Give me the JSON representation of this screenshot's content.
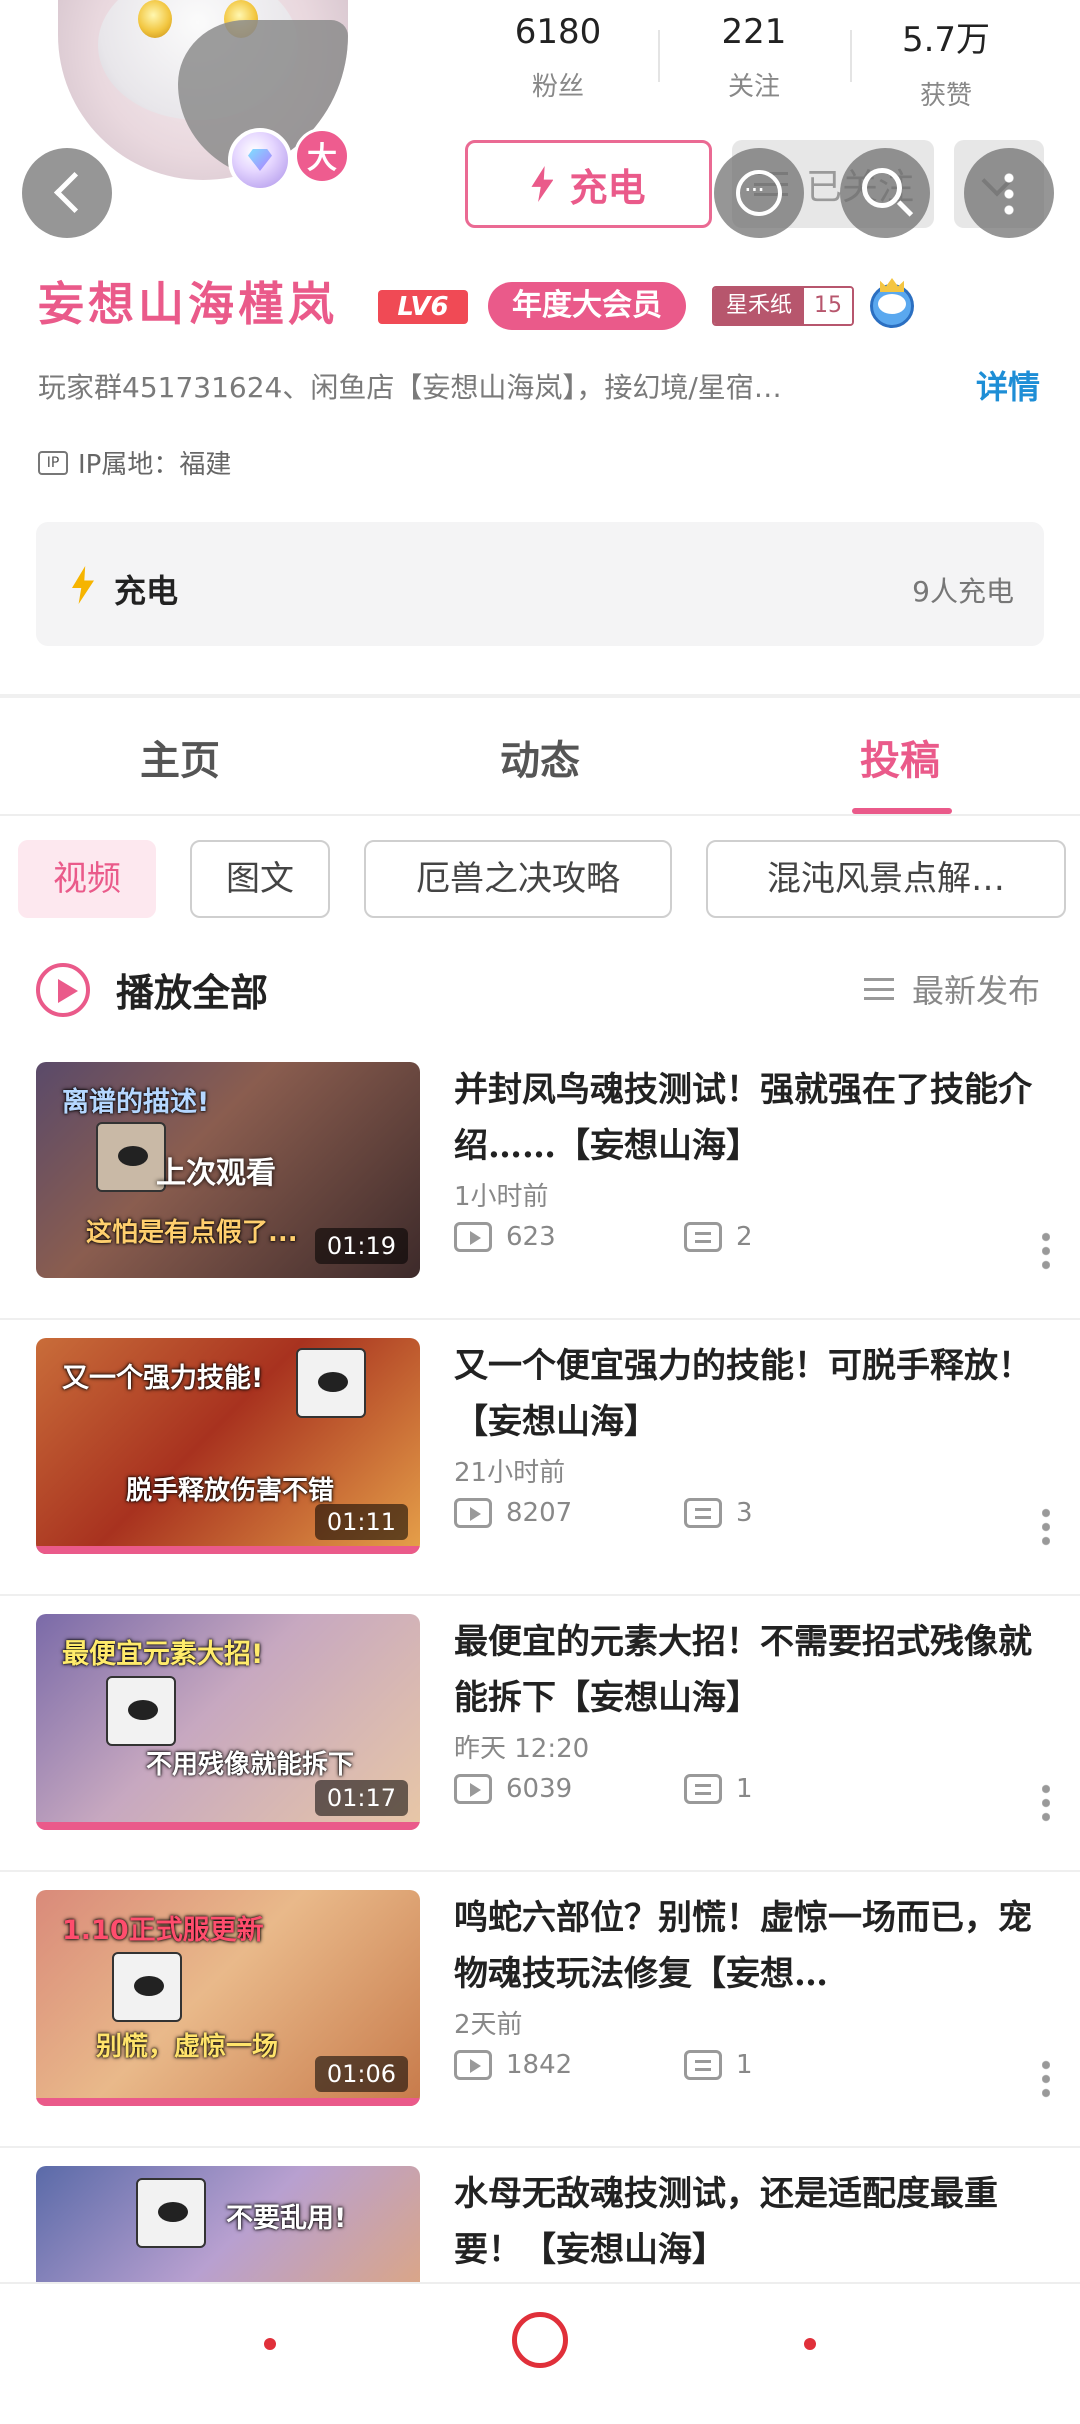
{
  "header": {
    "stats": [
      {
        "value": "6180",
        "label": "粉丝"
      },
      {
        "value": "221",
        "label": "关注"
      },
      {
        "value": "5.7万",
        "label": "获赞"
      }
    ],
    "avatar_badge": "大",
    "charge_button": "充电",
    "follow_button": "已关注",
    "colors": {
      "accent": "#ea5a8a",
      "link": "#1e8ed6",
      "level": "#f04a55",
      "nav": "#e0303a"
    }
  },
  "profile": {
    "name": "妄想山海槿岚",
    "level": "LV6",
    "member": "年度大会员",
    "medal_name": "星禾纸",
    "medal_level": "15",
    "bio": "玩家群451731624、闲鱼店【妄想山海岚】，接幻境/星宿…",
    "bio_more": "详情",
    "ip_label": "IP属地：福建",
    "charge_title": "充电",
    "charge_count": "9人充电"
  },
  "tabs": [
    "主页",
    "动态",
    "投稿"
  ],
  "active_tab": 2,
  "chips": [
    "视频",
    "图文",
    "厄兽之决攻略",
    "混沌风景点解…"
  ],
  "active_chip": 0,
  "list_header": {
    "play_all": "播放全部",
    "sort": "最新发布"
  },
  "videos": [
    {
      "title": "并封凤鸟魂技测试！强就强在了技能介绍……【妄想山海】",
      "date": "1小时前",
      "views": "623",
      "comments": "2",
      "duration": "01:19",
      "thumb_top": "离谱的描述!",
      "thumb_bottom": "这怕是有点假了...",
      "watched_label": "上次观看",
      "progress": 0
    },
    {
      "title": "又一个便宜强力的技能！可脱手释放！【妄想山海】",
      "date": "21小时前",
      "views": "8207",
      "comments": "3",
      "duration": "01:11",
      "thumb_top": "又一个强力技能!",
      "thumb_bottom": "脱手释放伤害不错",
      "progress": 1.0
    },
    {
      "title": "最便宜的元素大招！不需要招式残像就能拆下【妄想山海】",
      "date": "昨天 12:20",
      "views": "6039",
      "comments": "1",
      "duration": "01:17",
      "thumb_top": "最便宜元素大招!",
      "thumb_bottom": "不用残像就能拆下",
      "progress": 1.0
    },
    {
      "title": "鸣蛇六部位？别慌！虚惊一场而已，宠物魂技玩法修复【妄想…",
      "date": "2天前",
      "views": "1842",
      "comments": "1",
      "duration": "01:06",
      "thumb_top": "1.10正式服更新",
      "thumb_bottom": "别慌，虚惊一场",
      "progress": 1.0
    },
    {
      "title": "水母无敌魂技测试，还是适配度最重要！【妄想山海】",
      "date": "",
      "views": "",
      "comments": "",
      "duration": "",
      "thumb_top": "不要乱用!",
      "thumb_bottom": "",
      "progress": 0
    }
  ]
}
